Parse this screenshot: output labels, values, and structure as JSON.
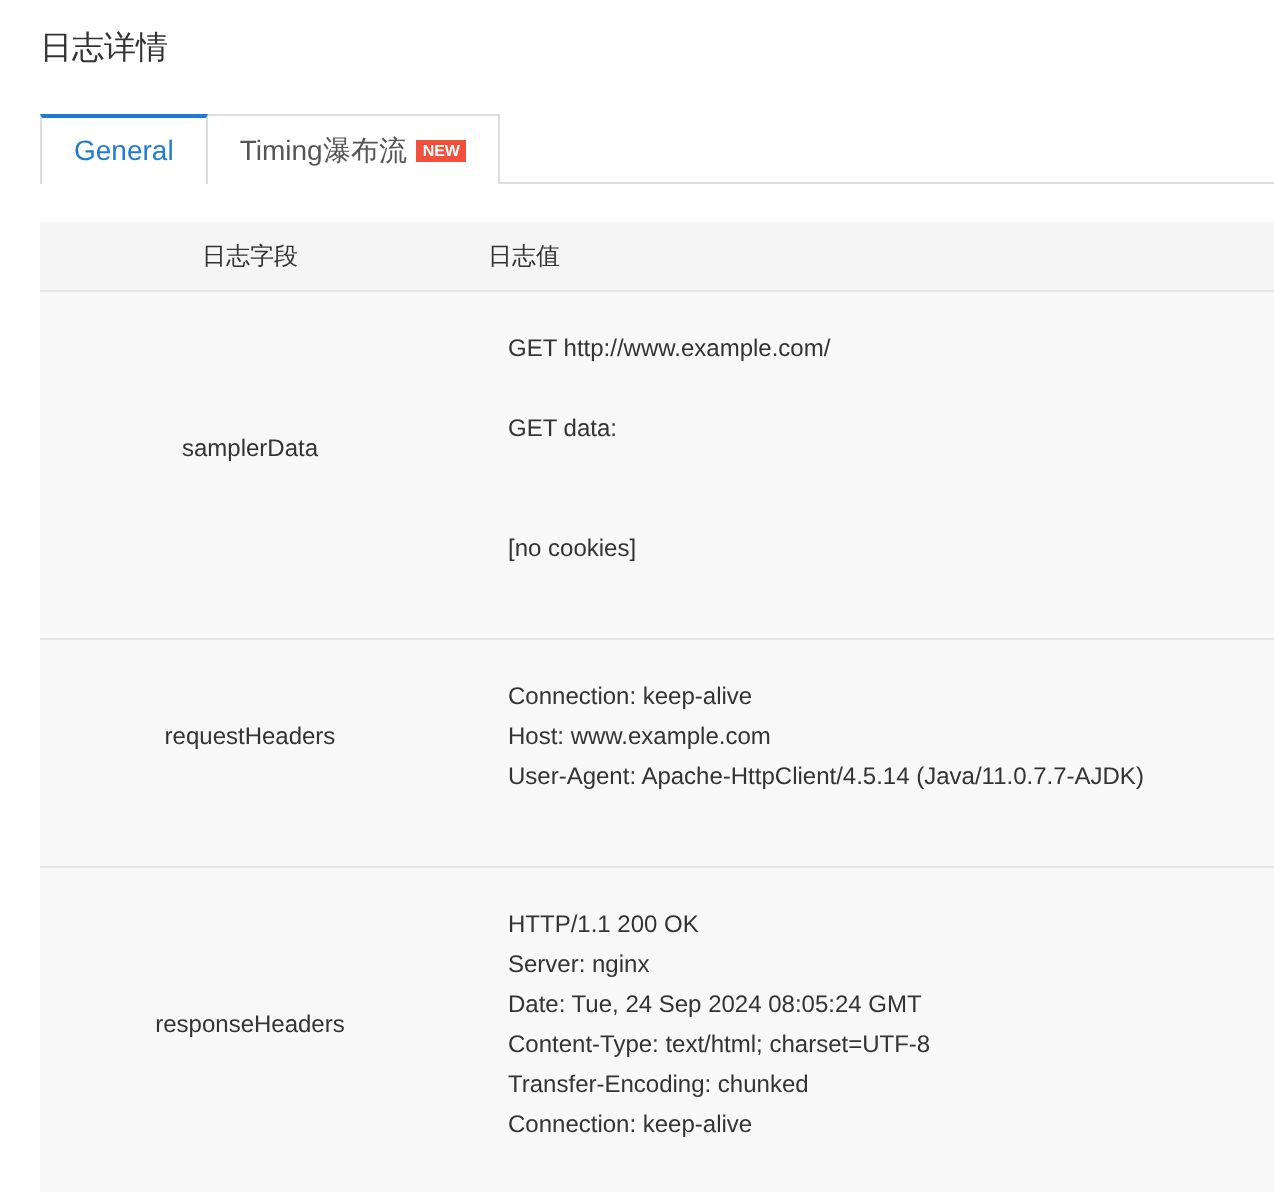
{
  "title": "日志详情",
  "tabs": [
    {
      "label": "General",
      "selected": true
    },
    {
      "label": "Timing瀑布流",
      "selected": false,
      "badge": "NEW"
    }
  ],
  "table": {
    "columns": [
      "日志字段",
      "日志值"
    ],
    "rows": [
      {
        "field": "samplerData",
        "value": "GET http://www.example.com/\n\nGET data:\n\n\n[no cookies]"
      },
      {
        "field": "requestHeaders",
        "value": "Connection: keep-alive\nHost: www.example.com\nUser-Agent: Apache-HttpClient/4.5.14 (Java/11.0.7.7-AJDK)"
      },
      {
        "field": "responseHeaders",
        "value": "HTTP/1.1 200 OK\nServer: nginx\nDate: Tue, 24 Sep 2024 08:05:24 GMT\nContent-Type: text/html; charset=UTF-8\nTransfer-Encoding: chunked\nConnection: keep-alive"
      }
    ]
  }
}
